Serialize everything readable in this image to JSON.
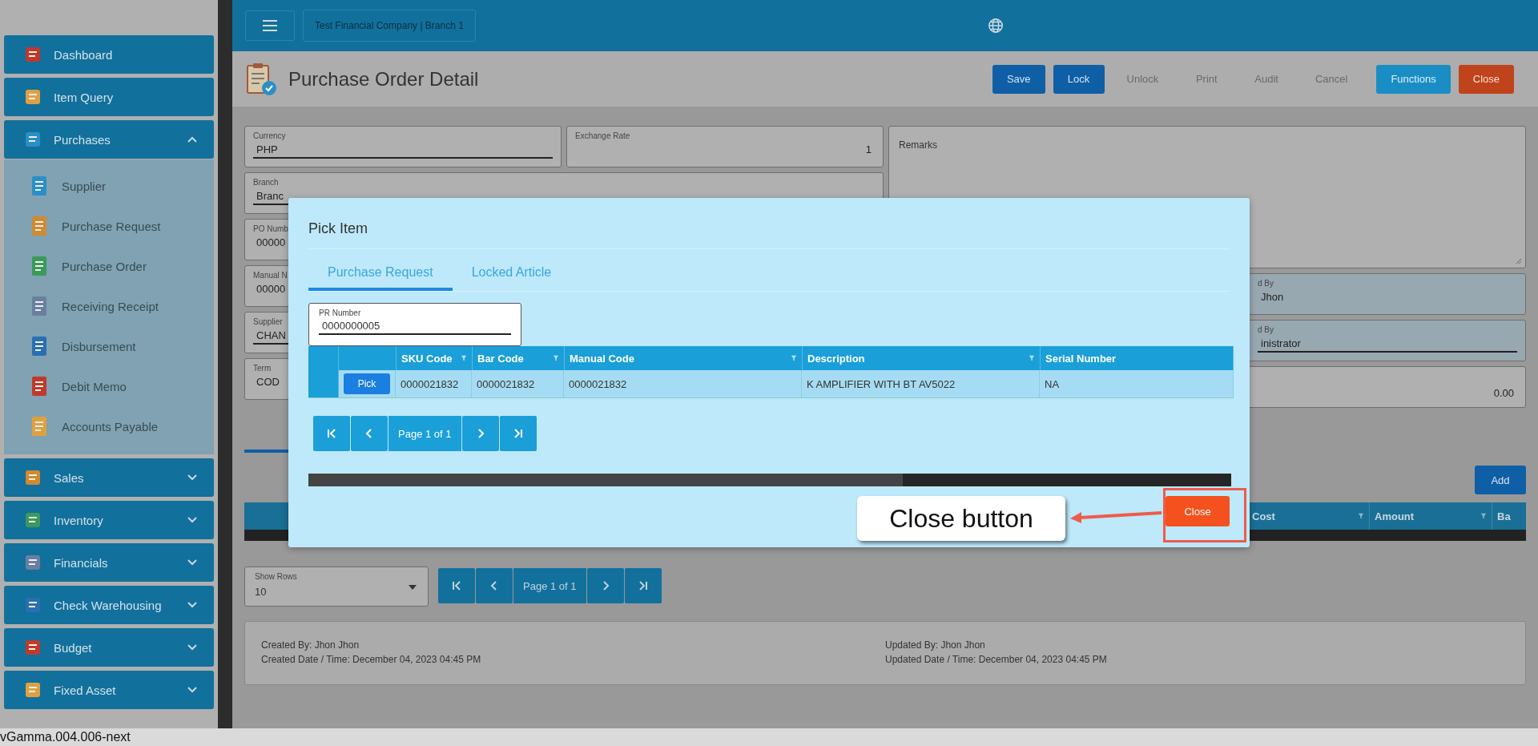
{
  "sidebar": {
    "items": [
      {
        "label": "Dashboard",
        "kind": "link"
      },
      {
        "label": "Item Query",
        "kind": "link"
      },
      {
        "label": "Purchases",
        "kind": "group",
        "expanded": true,
        "children": [
          {
            "label": "Supplier"
          },
          {
            "label": "Purchase Request"
          },
          {
            "label": "Purchase Order"
          },
          {
            "label": "Receiving Receipt"
          },
          {
            "label": "Disbursement"
          },
          {
            "label": "Debit Memo"
          },
          {
            "label": "Accounts Payable"
          }
        ]
      },
      {
        "label": "Sales",
        "kind": "group",
        "expanded": false
      },
      {
        "label": "Inventory",
        "kind": "group",
        "expanded": false
      },
      {
        "label": "Financials",
        "kind": "group",
        "expanded": false
      },
      {
        "label": "Check Warehousing",
        "kind": "group",
        "expanded": false
      },
      {
        "label": "Budget",
        "kind": "group",
        "expanded": false
      },
      {
        "label": "Fixed Asset",
        "kind": "group",
        "expanded": false
      }
    ]
  },
  "header": {
    "company": "Test Financial Company | Branch 1"
  },
  "page": {
    "title": "Purchase Order Detail",
    "actions": [
      {
        "label": "Save",
        "kind": "primary",
        "disabled": false
      },
      {
        "label": "Lock",
        "kind": "primary",
        "disabled": false
      },
      {
        "label": "Unlock",
        "disabled": true
      },
      {
        "label": "Print",
        "disabled": true
      },
      {
        "label": "Audit",
        "disabled": true
      },
      {
        "label": "Cancel",
        "disabled": true
      },
      {
        "label": "Functions",
        "kind": "info",
        "disabled": false
      },
      {
        "label": "Close",
        "kind": "danger",
        "disabled": false
      }
    ]
  },
  "form": {
    "currency": {
      "label": "Currency",
      "value": "PHP"
    },
    "exchange_rate": {
      "label": "Exchange Rate",
      "value": "1"
    },
    "left_fields": [
      {
        "label": "Branch",
        "value": "Branc",
        "kind": "select"
      },
      {
        "label": "PO Numb",
        "value": "00000",
        "kind": "text"
      },
      {
        "label": "Manual N",
        "value": "00000",
        "kind": "text"
      },
      {
        "label": "Supplier",
        "value": "CHAN",
        "kind": "select"
      },
      {
        "label": "Term",
        "value": "COD",
        "kind": "text"
      }
    ],
    "remarks": {
      "label": "Remarks"
    },
    "right_fields": [
      {
        "label": "d By",
        "value": "Jhon",
        "kind": "text"
      },
      {
        "label": "d By",
        "value": "inistrator",
        "kind": "select"
      },
      {
        "value": "0.00",
        "kind": "number"
      }
    ]
  },
  "items": {
    "add_label": "Add",
    "columns": [
      "Cost",
      "Amount",
      "Ba"
    ],
    "show_rows": {
      "label": "Show Rows",
      "value": "10"
    },
    "page_label": "Page 1 of 1"
  },
  "audit": {
    "created_by": "Created By: Jhon Jhon",
    "created_date": "Created Date / Time: December 04, 2023 04:45 PM",
    "updated_by": "Updated By: Jhon Jhon",
    "updated_date": "Updated Date / Time: December 04, 2023 04:45 PM"
  },
  "modal": {
    "title": "Pick Item",
    "tabs": [
      {
        "label": "Purchase Request",
        "selected": true
      },
      {
        "label": "Locked Article",
        "selected": false
      }
    ],
    "pr_number": {
      "label": "PR Number",
      "value": "0000000005"
    },
    "columns": [
      "SKU Code",
      "Bar Code",
      "Manual Code",
      "Description",
      "Serial Number"
    ],
    "rows": [
      {
        "action": "Pick",
        "cells": [
          "0000021832",
          "0000021832",
          "0000021832",
          "K AMPLIFIER WITH BT AV5022",
          "NA"
        ]
      }
    ],
    "page_label": "Page 1 of 1",
    "close_label": "Close"
  },
  "annotation": {
    "label": "Close button"
  },
  "version": "vGamma.004.006-next"
}
